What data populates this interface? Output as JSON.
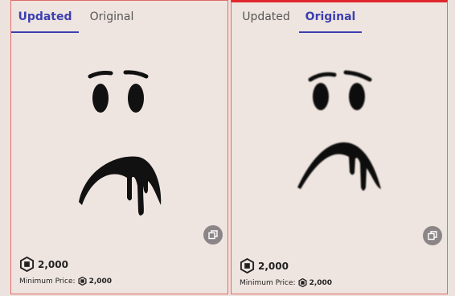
{
  "left": {
    "tabs": {
      "updated": "Updated",
      "original": "Original",
      "active": "updated"
    },
    "price": "2,000",
    "min_price_label": "Minimum Price:",
    "min_price_value": "2,000"
  },
  "right": {
    "tabs": {
      "updated": "Updated",
      "original": "Original",
      "active": "original"
    },
    "price": "2,000",
    "min_price_label": "Minimum Price:",
    "min_price_value": "2,000"
  },
  "icons": {
    "currency": "robux-icon",
    "copy": "copy-icon"
  },
  "colors": {
    "accent": "#3c3fb0",
    "border": "#e36a6a",
    "card_bg": "#efe5e0",
    "button_bg": "#8b8587"
  }
}
